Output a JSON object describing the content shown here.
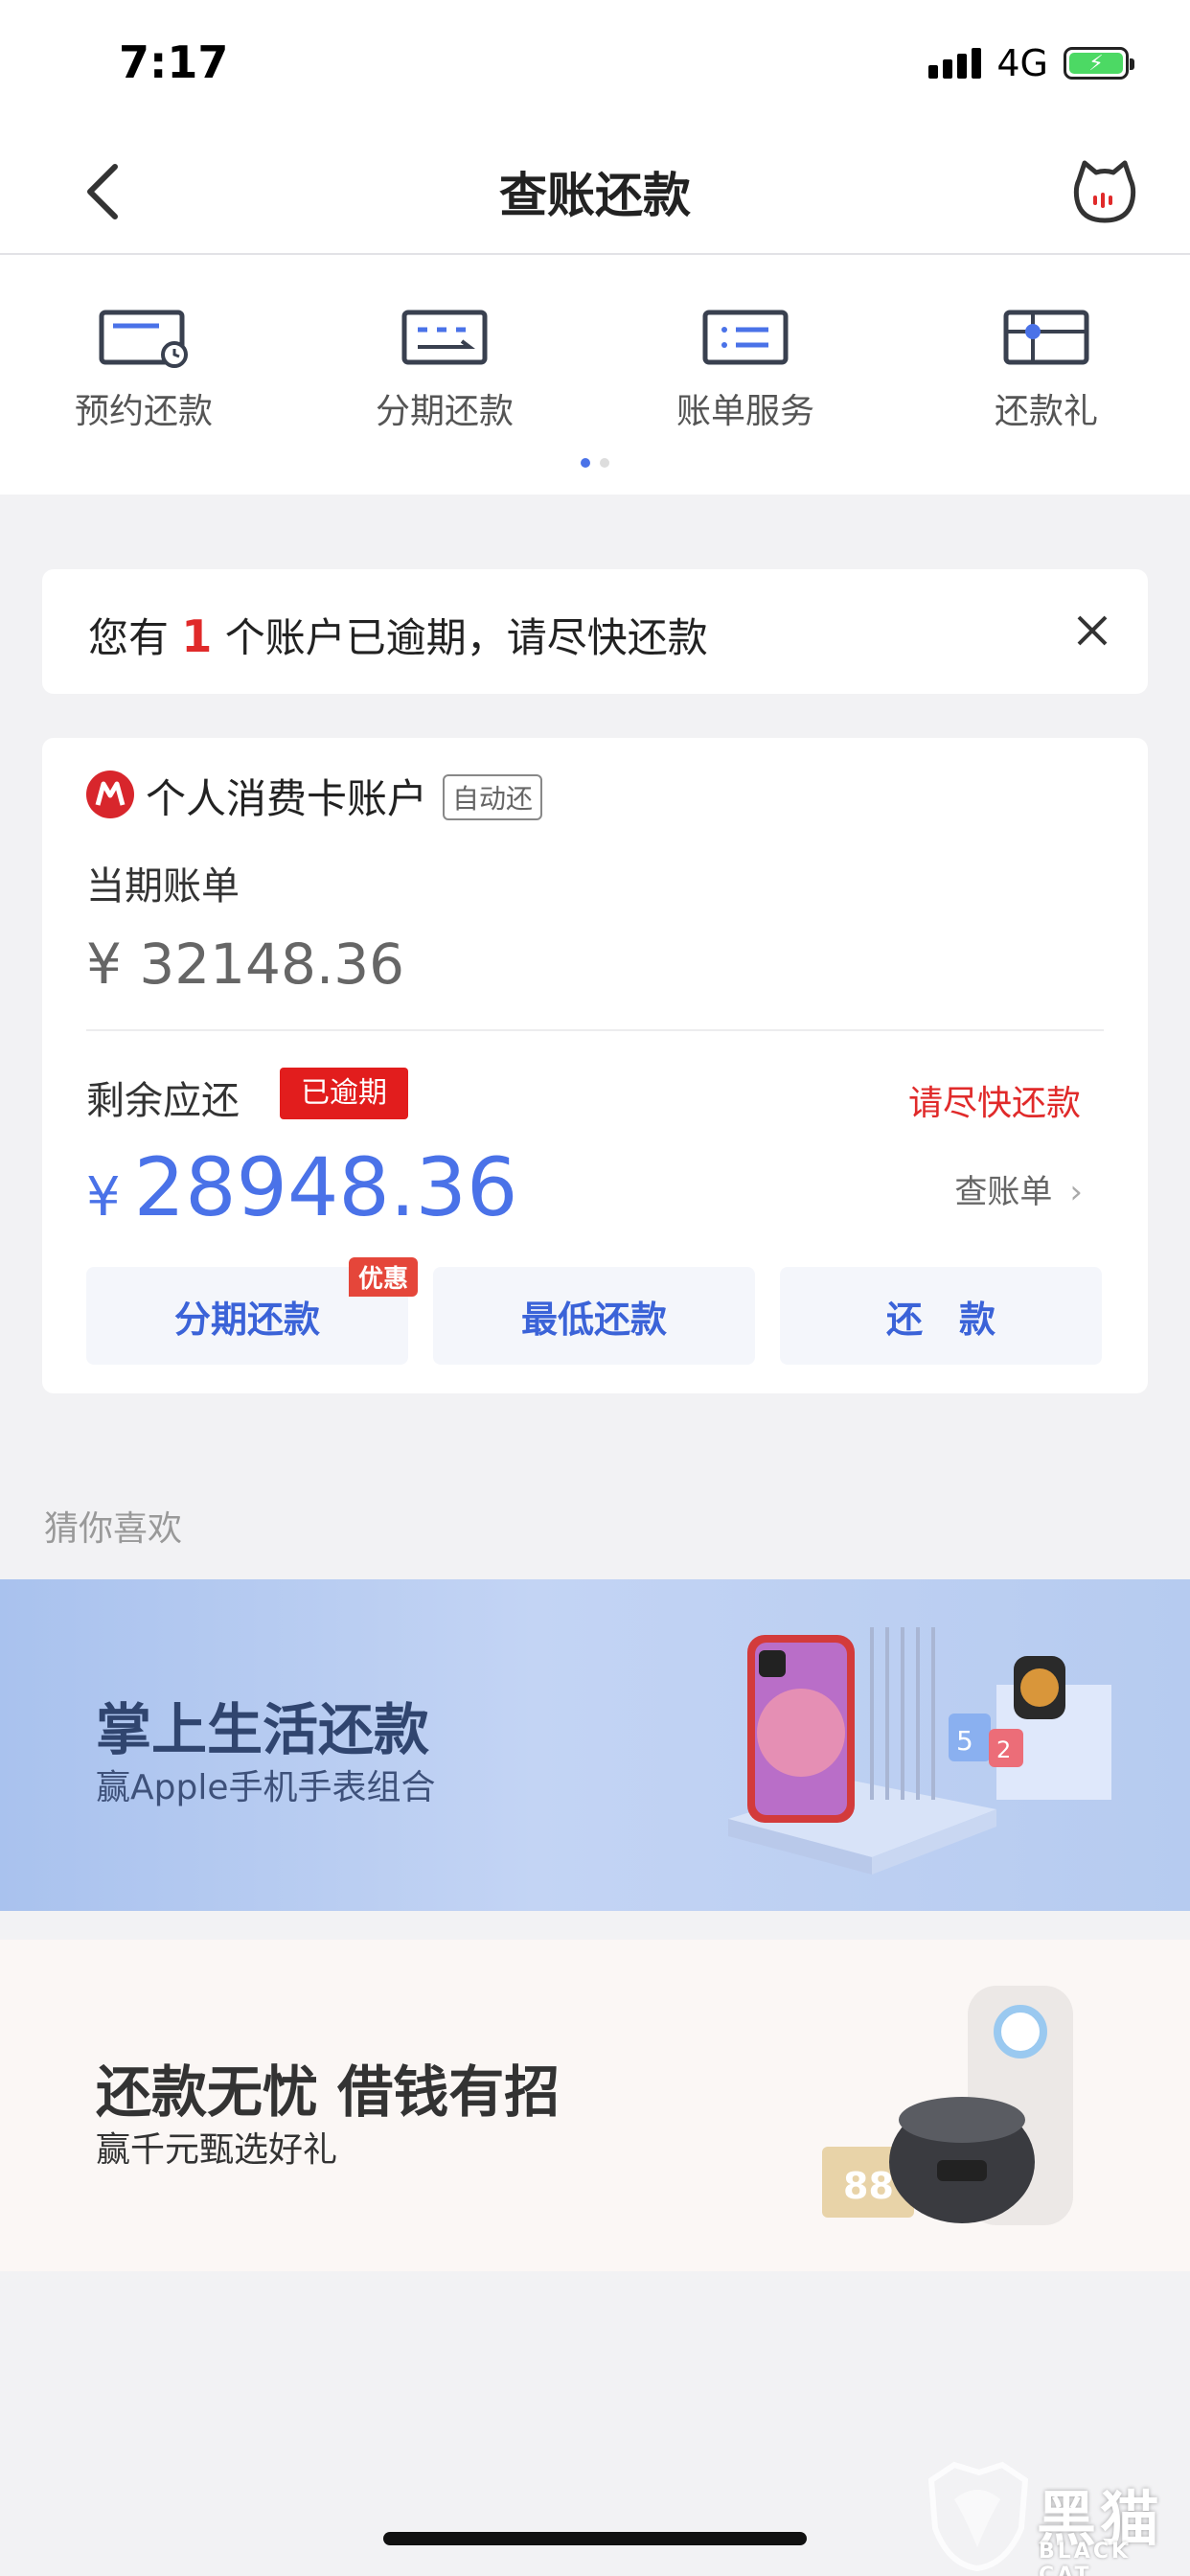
{
  "status_bar": {
    "time": "7:17",
    "network": "4G"
  },
  "nav": {
    "title": "查账还款"
  },
  "quick_menu": [
    {
      "label": "预约还款",
      "icon": "scheduled-repay-icon"
    },
    {
      "label": "分期还款",
      "icon": "installment-icon"
    },
    {
      "label": "账单服务",
      "icon": "bill-service-icon"
    },
    {
      "label": "还款礼",
      "icon": "repay-gift-icon"
    }
  ],
  "notice": {
    "prefix": "您有",
    "count": "1",
    "suffix": "个账户已逾期，请尽快还款"
  },
  "account": {
    "name": "个人消费卡账户",
    "tag": "自动还",
    "bill_label": "当期账单",
    "bill_amount": "¥ 32148.36",
    "remain_label": "剩余应还",
    "overdue_badge": "已逾期",
    "hurry_text": "请尽快还款",
    "currency": "¥",
    "remain_amount": "28948.36",
    "view_bill": "查账单",
    "buttons": {
      "installment": "分期还款",
      "installment_tag": "优惠",
      "minimum": "最低还款",
      "repay": "还　款"
    }
  },
  "recommend": {
    "title": "猜你喜欢",
    "banner1": {
      "title": "掌上生活还款",
      "subtitle": "赢Apple手机手表组合",
      "coupon1": "5",
      "coupon2": "2"
    },
    "banner2": {
      "title": "还款无忧 借钱有招",
      "subtitle": "赢千元甄选好礼",
      "coupon": "88"
    }
  },
  "watermark": {
    "text": "黑猫",
    "sub": "BLACK CAT"
  },
  "colors": {
    "accent": "#4a72e8",
    "danger": "#e02a2a",
    "brand_red": "#d8262c"
  }
}
